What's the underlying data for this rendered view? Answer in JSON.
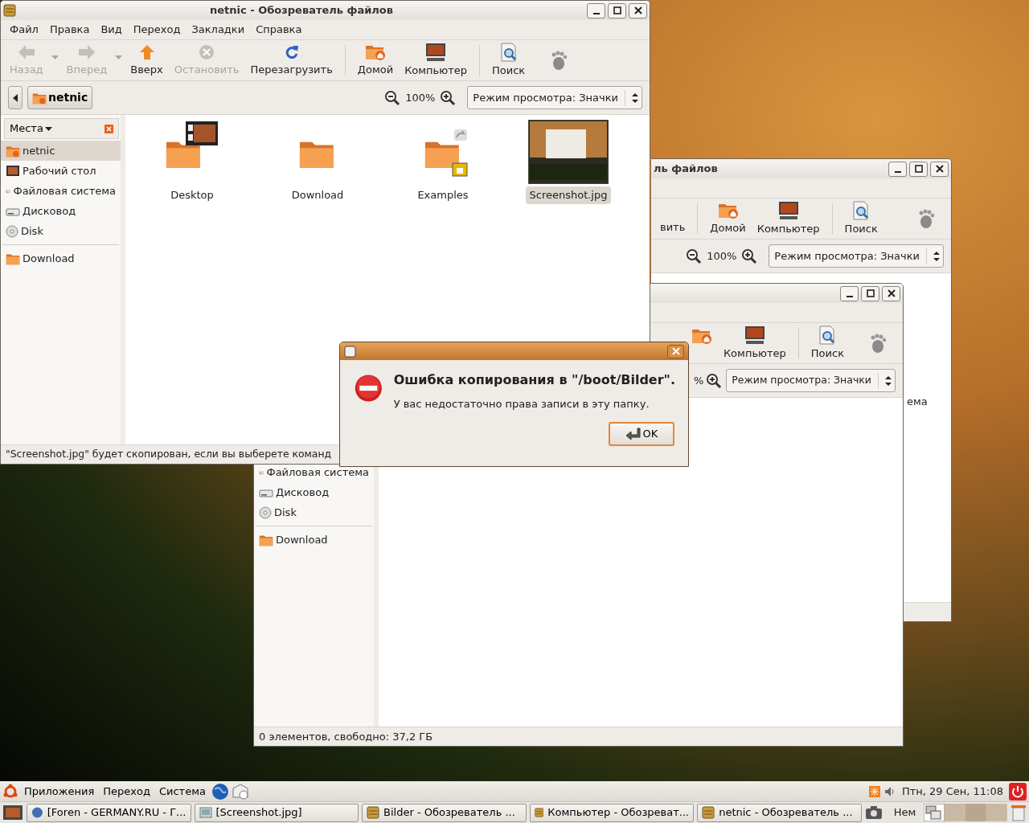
{
  "windows": [
    {
      "title": "ль файлов",
      "toolbar": [
        {
          "kind": "text",
          "label": "вить"
        },
        {
          "kind": "separator"
        },
        {
          "kind": "home",
          "label": "Домой"
        },
        {
          "kind": "computer",
          "label": "Компьютер"
        },
        {
          "kind": "separator"
        },
        {
          "kind": "search",
          "label": "Поиск"
        }
      ],
      "zoom": "100%",
      "view_mode": "Режим просмотра: Значки",
      "content": [
        "ема"
      ]
    },
    {
      "toolbar": [
        {
          "kind": "home"
        },
        {
          "kind": "computer",
          "label": "Компьютер"
        },
        {
          "kind": "separator"
        },
        {
          "kind": "search",
          "label": "Поиск"
        }
      ],
      "zoom": "%",
      "view_mode": "Режим просмотра: Значки",
      "places": [
        {
          "kind": "drive",
          "label": "Файловая система"
        },
        {
          "kind": "drive",
          "label": "Дисковод"
        },
        {
          "kind": "cd",
          "label": "Disk"
        }
      ],
      "bookmarks": [
        {
          "kind": "folder",
          "label": "Download"
        }
      ],
      "status": "0 элементов, свободно: 37,2 ГБ"
    },
    {
      "title": "netnic - Обозреватель файлов",
      "menu": [
        "Файл",
        "Правка",
        "Вид",
        "Переход",
        "Закладки",
        "Справка"
      ],
      "toolbar": [
        {
          "kind": "back",
          "label": "Назад",
          "disabled": true,
          "has_menu": true
        },
        {
          "kind": "forward",
          "label": "Вперед",
          "disabled": true,
          "has_menu": true
        },
        {
          "kind": "up",
          "label": "Вверх",
          "disabled": false
        },
        {
          "kind": "stop",
          "label": "Остановить",
          "disabled": true
        },
        {
          "kind": "reload",
          "label": "Перезагрузить",
          "disabled": false
        },
        {
          "kind": "separator"
        },
        {
          "kind": "home",
          "label": "Домой"
        },
        {
          "kind": "computer",
          "label": "Компьютер"
        },
        {
          "kind": "separator"
        },
        {
          "kind": "search",
          "label": "Поиск"
        }
      ],
      "path": "netnic",
      "zoom": "100%",
      "view_mode": "Режим просмотра: Значки",
      "sidebar_title": "Места",
      "places": [
        {
          "kind": "home",
          "label": "netnic",
          "selected": true
        },
        {
          "kind": "desktop",
          "label": "Рабочий стол",
          "selected": false
        },
        {
          "kind": "drive",
          "label": "Файловая система",
          "selected": false
        },
        {
          "kind": "drive",
          "label": "Дисковод",
          "selected": false
        },
        {
          "kind": "cd",
          "label": "Disk",
          "selected": false
        }
      ],
      "bookmarks": [
        {
          "kind": "folder",
          "label": "Download",
          "selected": false
        }
      ],
      "files": [
        {
          "kind": "desktop-folder",
          "name": "Desktop",
          "selected": false
        },
        {
          "kind": "folder",
          "name": "Download",
          "selected": false
        },
        {
          "kind": "link-folder",
          "name": "Examples",
          "selected": false
        },
        {
          "kind": "image",
          "name": "Screenshot.jpg",
          "selected": true
        }
      ],
      "status": "\"Screenshot.jpg\" будет скопирован, если вы выберете команд"
    }
  ],
  "dialog": {
    "heading": "Ошибка копирования в \"/boot/Bilder\".",
    "message": "У вас недостаточно права записи в эту папку.",
    "button": "OK"
  },
  "top_panel": {
    "menus": [
      "Приложения",
      "Переход",
      "Система"
    ],
    "clock": "Птн, 29 Сен, 11:08"
  },
  "taskbar": {
    "tasks": [
      {
        "kind": "browser",
        "label": "[Foren - GERMANY.RU - Г..."
      },
      {
        "kind": "image",
        "label": "[Screenshot.jpg]"
      },
      {
        "kind": "files",
        "label": "Bilder - Обозреватель ..."
      },
      {
        "kind": "files",
        "label": "Компьютер - Обозреват..."
      },
      {
        "kind": "files",
        "label": "netnic - Обозреватель ..."
      }
    ],
    "keyboard": "Нем"
  }
}
